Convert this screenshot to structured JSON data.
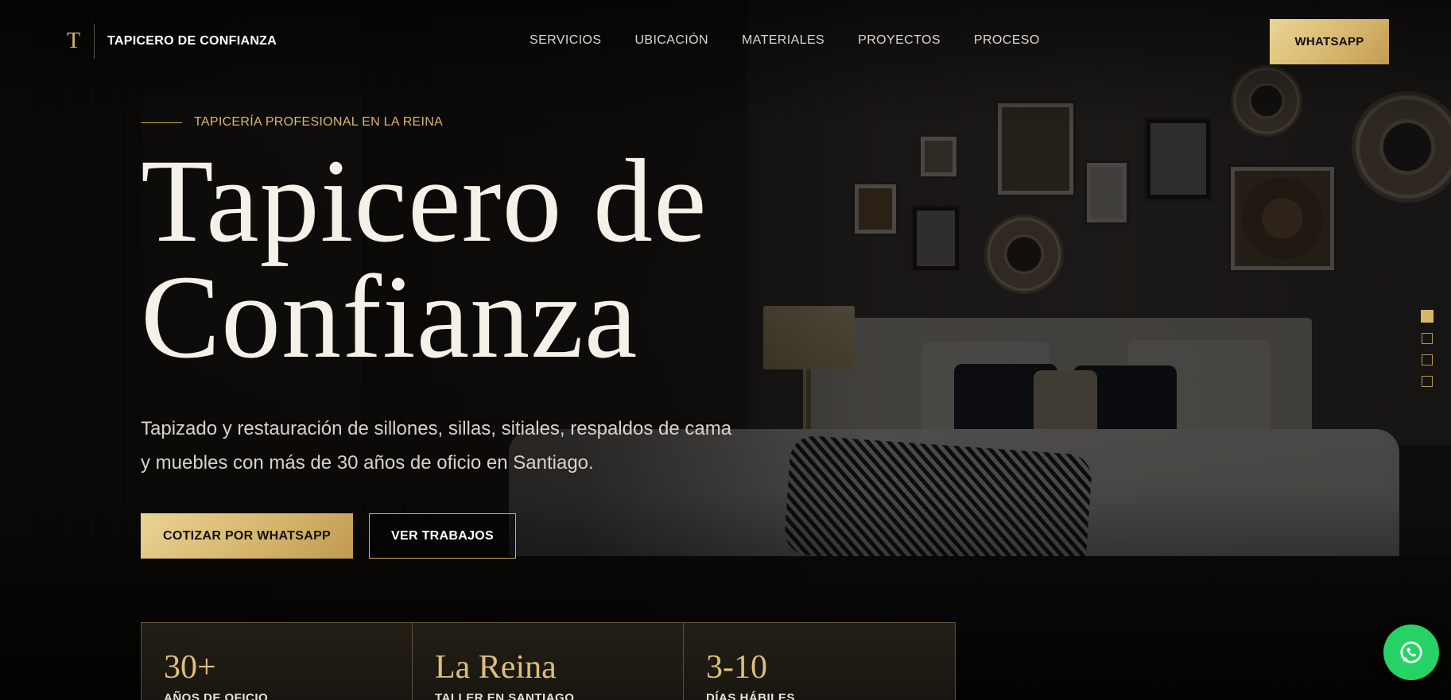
{
  "header": {
    "logo_mark": "T",
    "brand": "TAPICERO DE CONFIANZA",
    "nav": [
      {
        "label": "SERVICIOS"
      },
      {
        "label": "UBICACIÓN"
      },
      {
        "label": "MATERIALES"
      },
      {
        "label": "PROYECTOS"
      },
      {
        "label": "PROCESO"
      }
    ],
    "cta": "WHATSAPP"
  },
  "hero": {
    "eyebrow": "TAPICERÍA PROFESIONAL EN LA REINA",
    "title_line1": "Tapicero de",
    "title_line2": "Confianza",
    "lead": "Tapizado y restauración de sillones, sillas, sitiales, respaldos de cama y muebles con más de 30 años de oficio en Santiago.",
    "primary_cta": "COTIZAR POR WHATSAPP",
    "secondary_cta": "VER TRABAJOS"
  },
  "stats": [
    {
      "value": "30+",
      "label": "AÑOS DE OFICIO"
    },
    {
      "value": "La Reina",
      "label": "TALLER EN SANTIAGO"
    },
    {
      "value": "3-10",
      "label": "DÍAS HÁBILES"
    }
  ],
  "slider": {
    "count": 4,
    "active_index": 0
  },
  "colors": {
    "accent_gold": "#d7b86f",
    "background": "#0b0a09",
    "whatsapp_green": "#25d366"
  },
  "icons": {
    "floating": "whatsapp-icon"
  }
}
